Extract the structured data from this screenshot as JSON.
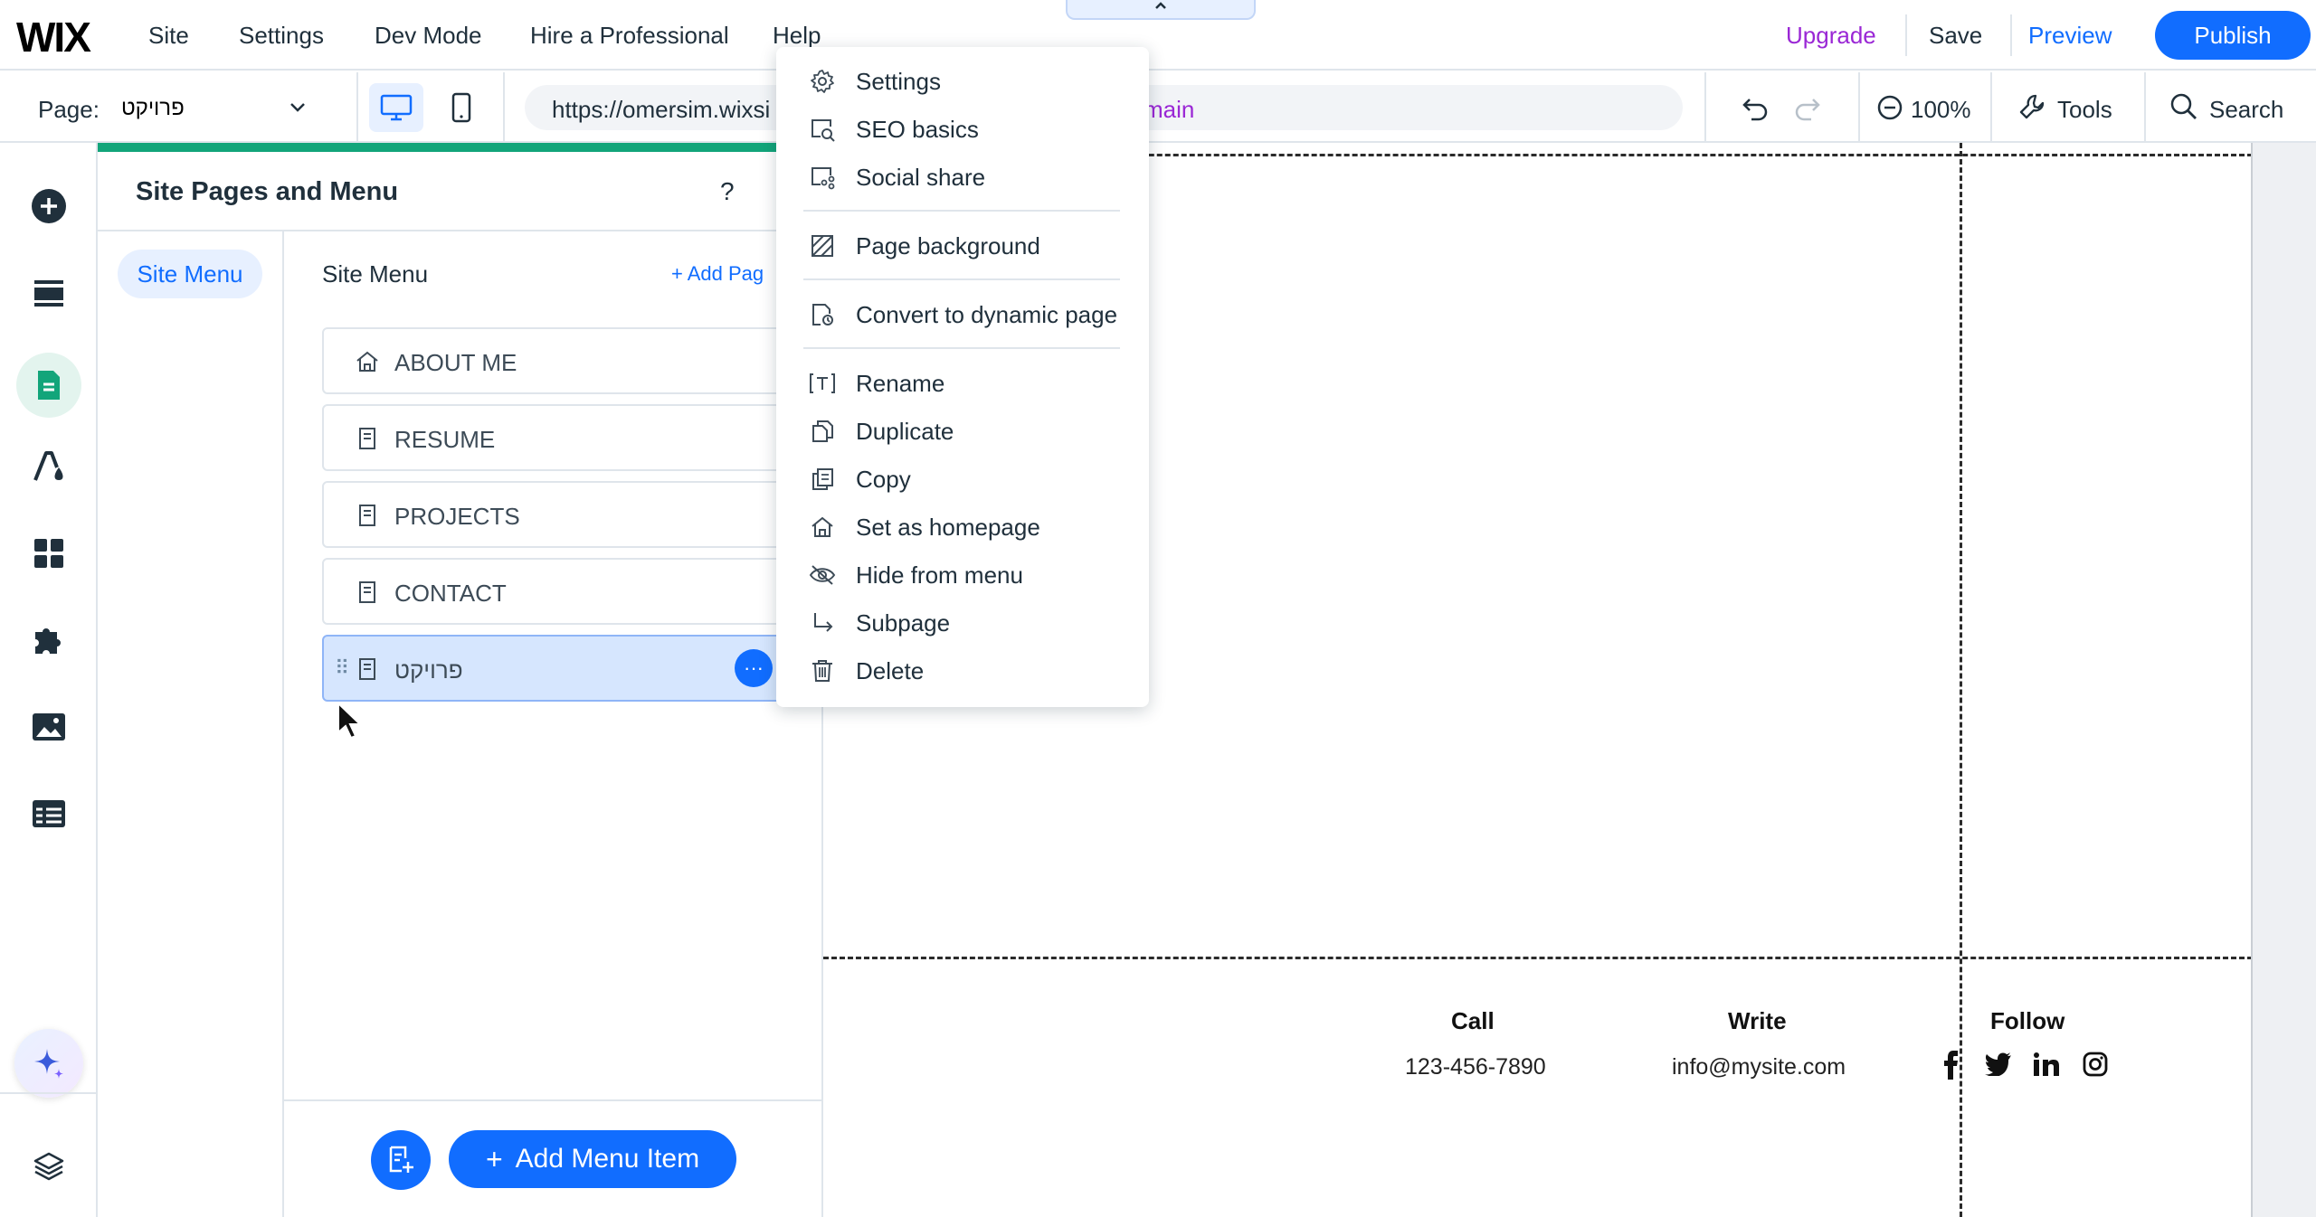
{
  "topbar": {
    "logo": "WIX",
    "menu": [
      "Site",
      "Settings",
      "Dev Mode",
      "Hire a Professional",
      "Help"
    ],
    "upgrade": "Upgrade",
    "save": "Save",
    "preview": "Preview",
    "publish": "Publish",
    "colors": {
      "accent": "#116dff",
      "upgrade": "#9a27d5"
    }
  },
  "toolbar": {
    "page_label": "Page:",
    "page_value": "פרויקט",
    "url": "https://omersim.wixsi",
    "url_domain": "main",
    "zoom": "100%",
    "tools": "Tools",
    "search": "Search"
  },
  "panel": {
    "title": "Site Pages and Menu",
    "help": "?",
    "tab": "Site Menu",
    "section_title": "Site Menu",
    "add_page": "+ Add Pag",
    "pages": [
      {
        "label": "ABOUT ME",
        "icon": "home-icon"
      },
      {
        "label": "RESUME",
        "icon": "page-icon"
      },
      {
        "label": "PROJECTS",
        "icon": "page-icon"
      },
      {
        "label": "CONTACT",
        "icon": "page-icon"
      },
      {
        "label": "פרויקט",
        "icon": "page-icon",
        "selected": true
      }
    ],
    "more_button": "···",
    "add_menu_item": "Add Menu Item"
  },
  "context_menu": {
    "items": [
      {
        "label": "Settings",
        "icon": "gear-icon"
      },
      {
        "label": "SEO basics",
        "icon": "seo-search-icon"
      },
      {
        "label": "Social share",
        "icon": "social-share-icon"
      },
      {
        "label": "Page background",
        "icon": "page-background-icon"
      },
      {
        "label": "Convert to dynamic page",
        "icon": "dynamic-page-icon"
      },
      {
        "label": "Rename",
        "icon": "rename-icon"
      },
      {
        "label": "Duplicate",
        "icon": "duplicate-icon"
      },
      {
        "label": "Copy",
        "icon": "copy-icon"
      },
      {
        "label": "Set as homepage",
        "icon": "home-icon"
      },
      {
        "label": "Hide from menu",
        "icon": "hide-eye-icon"
      },
      {
        "label": "Subpage",
        "icon": "subpage-arrow-icon"
      },
      {
        "label": "Delete",
        "icon": "trash-icon"
      }
    ]
  },
  "site_footer": {
    "call_heading": "Call",
    "call_value": "123-456-7890",
    "write_heading": "Write",
    "write_value": "info@mysite.com",
    "follow_heading": "Follow",
    "social": [
      "facebook-icon",
      "twitter-icon",
      "linkedin-icon",
      "instagram-icon"
    ]
  }
}
